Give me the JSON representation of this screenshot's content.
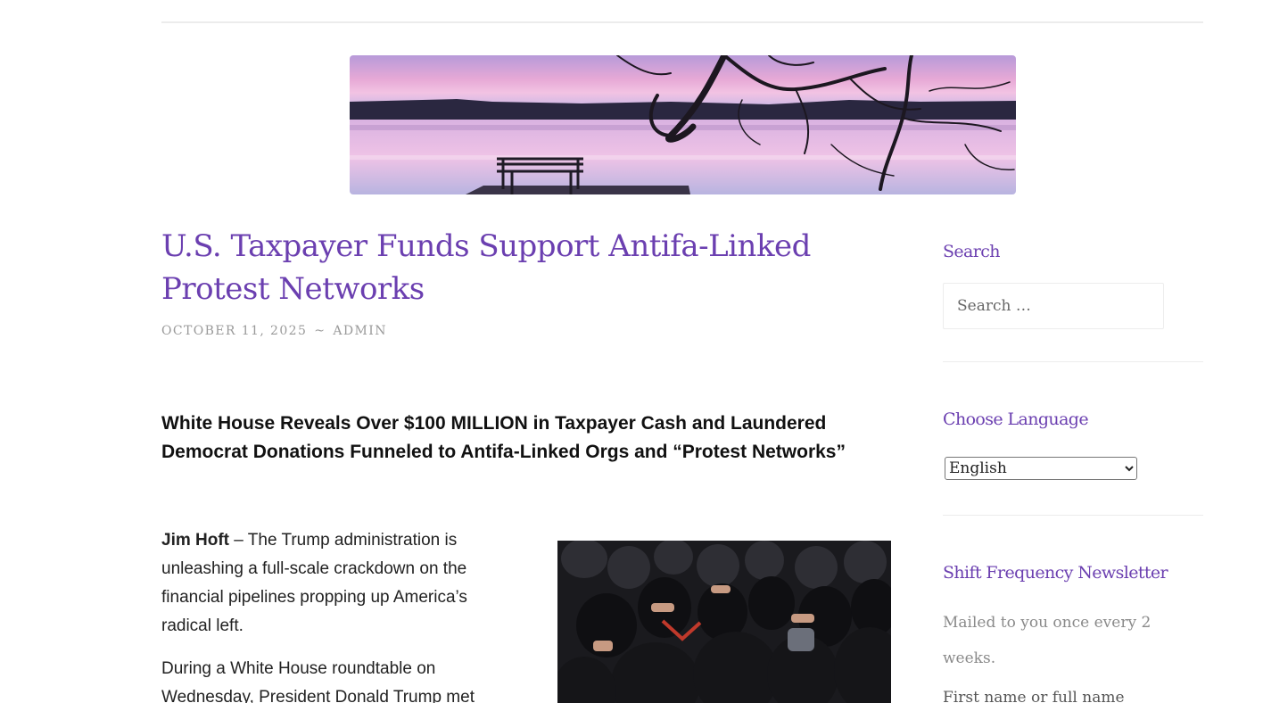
{
  "header": {
    "banner_icon": "lake-bench-banner-image"
  },
  "post": {
    "title": "U.S. Taxpayer Funds Support Antifa-Linked Protest Networks",
    "date": "OCTOBER 11, 2025",
    "separator": "~",
    "author": "ADMIN",
    "lead": "White House Reveals Over $100 MILLION in Taxpayer Cash and Laundered Democrat Donations Funneled to Antifa-Linked Orgs and “Protest Networks”",
    "byline": "Jim Hoft",
    "paragraph1_rest": " – The Trump administration is unleashing a full-scale crackdown on the financial pipelines propping up America’s radical left.",
    "paragraph2": "During a White House roundtable on Wednesday, President Donald Trump met",
    "photo_icon": "masked-protesters-photo"
  },
  "sidebar": {
    "search": {
      "title": "Search",
      "placeholder": "Search …"
    },
    "language": {
      "title": "Choose Language",
      "selected": "English"
    },
    "newsletter": {
      "title": "Shift Frequency Newsletter",
      "description": "Mailed to you once every 2 weeks.",
      "field_label": "First name or full name"
    }
  },
  "colors": {
    "accent": "#6b3fb0",
    "meta": "#9a9a9a",
    "text": "#222222"
  }
}
